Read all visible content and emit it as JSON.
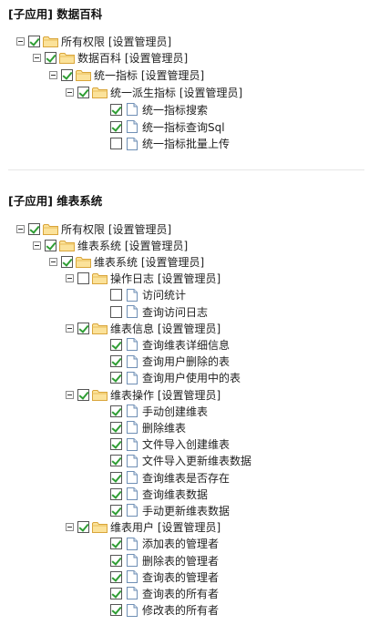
{
  "sections": [
    {
      "title": "[子应用] 数据百科",
      "nodes": [
        {
          "label": "所有权限 [设置管理员]",
          "type": "folder",
          "checked": true
        },
        {
          "label": "数据百科 [设置管理员]",
          "type": "folder",
          "checked": true
        },
        {
          "label": "统一指标 [设置管理员]",
          "type": "folder",
          "checked": true
        },
        {
          "label": "统一派生指标 [设置管理员]",
          "type": "folder",
          "checked": true
        },
        {
          "label": "统一指标搜索",
          "type": "file",
          "checked": true
        },
        {
          "label": "统一指标查询Sql",
          "type": "file",
          "checked": true
        },
        {
          "label": "统一指标批量上传",
          "type": "file",
          "checked": false
        }
      ]
    },
    {
      "title": "[子应用] 维表系统",
      "nodes": [
        {
          "label": "所有权限 [设置管理员]",
          "type": "folder",
          "checked": true
        },
        {
          "label": "维表系统 [设置管理员]",
          "type": "folder",
          "checked": true
        },
        {
          "label": "维表系统 [设置管理员]",
          "type": "folder",
          "checked": true
        },
        {
          "label": "操作日志 [设置管理员]",
          "type": "folder",
          "checked": false
        },
        {
          "label": "访问统计",
          "type": "file",
          "checked": false
        },
        {
          "label": "查询访问日志",
          "type": "file",
          "checked": false
        },
        {
          "label": "维表信息 [设置管理员]",
          "type": "folder",
          "checked": true
        },
        {
          "label": "查询维表详细信息",
          "type": "file",
          "checked": true
        },
        {
          "label": "查询用户删除的表",
          "type": "file",
          "checked": true
        },
        {
          "label": "查询用户使用中的表",
          "type": "file",
          "checked": true
        },
        {
          "label": "维表操作 [设置管理员]",
          "type": "folder",
          "checked": true
        },
        {
          "label": "手动创建维表",
          "type": "file",
          "checked": true
        },
        {
          "label": "删除维表",
          "type": "file",
          "checked": true
        },
        {
          "label": "文件导入创建维表",
          "type": "file",
          "checked": true
        },
        {
          "label": "文件导入更新维表数据",
          "type": "file",
          "checked": true
        },
        {
          "label": "查询维表是否存在",
          "type": "file",
          "checked": true
        },
        {
          "label": "查询维表数据",
          "type": "file",
          "checked": true
        },
        {
          "label": "手动更新维表数据",
          "type": "file",
          "checked": true
        },
        {
          "label": "维表用户 [设置管理员]",
          "type": "folder",
          "checked": true
        },
        {
          "label": "添加表的管理者",
          "type": "file",
          "checked": true
        },
        {
          "label": "删除表的管理者",
          "type": "file",
          "checked": true
        },
        {
          "label": "查询表的管理者",
          "type": "file",
          "checked": true
        },
        {
          "label": "查询表的所有者",
          "type": "file",
          "checked": true
        },
        {
          "label": "修改表的所有者",
          "type": "file",
          "checked": true
        }
      ]
    }
  ]
}
